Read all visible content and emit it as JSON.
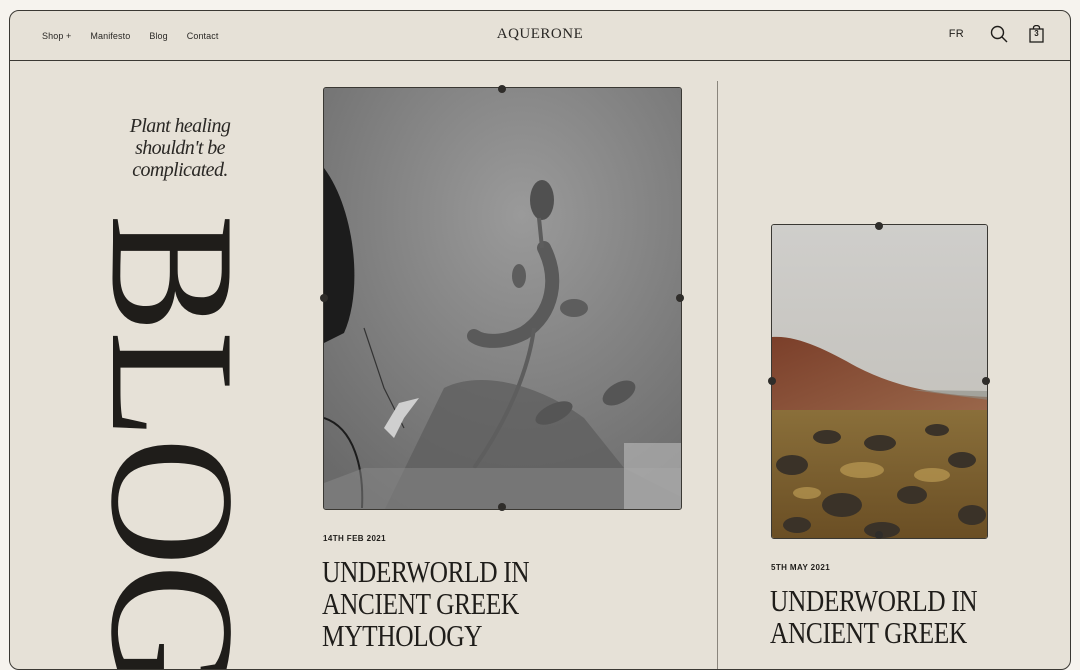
{
  "nav": {
    "items": [
      "Shop +",
      "Manifesto",
      "Blog",
      "Contact"
    ]
  },
  "logo": "AQUERONE",
  "tools": {
    "language": "FR",
    "search_icon": "search-icon",
    "cart_icon": "shopping-bag-icon",
    "cart_count": "3"
  },
  "hero": {
    "tagline": "Plant healing shouldn't be complicated.",
    "title": "BLOG"
  },
  "posts": [
    {
      "date": "14TH FEB 2021",
      "title": "UNDERWORLD IN ANCIENT GREEK MYTHOLOGY",
      "image": "shadow-flowers-photo"
    },
    {
      "date": "5TH MAY 2021",
      "title": "UNDERWORLD IN ANCIENT GREEK",
      "image": "moss-landscape-photo"
    }
  ],
  "colors": {
    "background": "#e6e1d7",
    "ink": "#1f1d1a",
    "border": "#3a3833"
  }
}
